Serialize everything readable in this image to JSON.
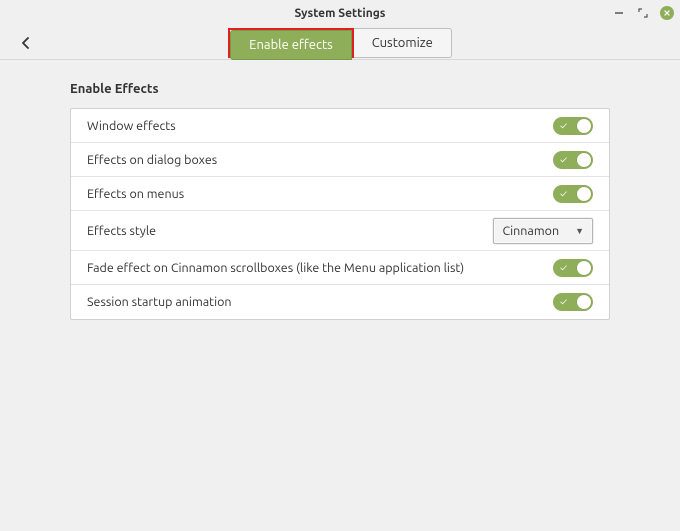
{
  "window": {
    "title": "System Settings"
  },
  "tabs": {
    "enable_effects": "Enable effects",
    "customize": "Customize"
  },
  "section": {
    "title": "Enable Effects"
  },
  "rows": {
    "window_effects": {
      "label": "Window effects",
      "on": true
    },
    "dialog_effects": {
      "label": "Effects on dialog boxes",
      "on": true
    },
    "menu_effects": {
      "label": "Effects on menus",
      "on": true
    },
    "effects_style": {
      "label": "Effects style",
      "value": "Cinnamon"
    },
    "fade_scrollboxes": {
      "label": "Fade effect on Cinnamon scrollboxes (like the Menu application list)",
      "on": true
    },
    "session_startup": {
      "label": "Session startup animation",
      "on": true
    }
  }
}
